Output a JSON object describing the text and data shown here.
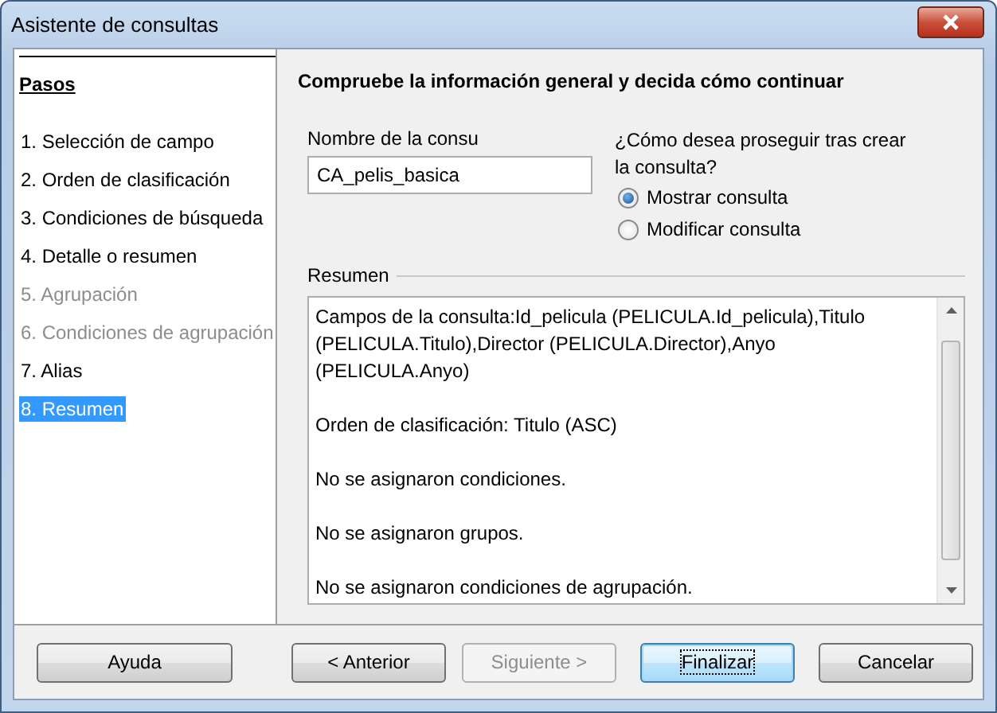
{
  "window": {
    "title": "Asistente de consultas"
  },
  "steps": {
    "heading": "Pasos",
    "items": [
      {
        "label": "1. Selección de campo",
        "selected": false,
        "disabled": false
      },
      {
        "label": "2. Orden de clasificación",
        "selected": false,
        "disabled": false
      },
      {
        "label": "3. Condiciones de búsqueda",
        "selected": false,
        "disabled": false
      },
      {
        "label": "4. Detalle o resumen",
        "selected": false,
        "disabled": false
      },
      {
        "label": "5. Agrupación",
        "selected": false,
        "disabled": true
      },
      {
        "label": "6. Condiciones de agrupación",
        "selected": false,
        "disabled": true
      },
      {
        "label": "7. Alias",
        "selected": false,
        "disabled": false
      },
      {
        "label": "8. Resumen",
        "selected": true,
        "disabled": false
      }
    ]
  },
  "page": {
    "heading": "Compruebe la información general y decida cómo continuar",
    "name_field": {
      "label": "Nombre de la consu",
      "value": "CA_pelis_basica"
    },
    "continue": {
      "question": "¿Cómo desea proseguir tras crear la consulta?",
      "options": [
        {
          "label": "Mostrar consulta",
          "selected": true
        },
        {
          "label": "Modificar consulta",
          "selected": false
        }
      ]
    },
    "summary": {
      "label": "Resumen",
      "lines": [
        "Campos de la consulta:Id_pelicula (PELICULA.Id_pelicula),Titulo (PELICULA.Titulo),Director (PELICULA.Director),Anyo (PELICULA.Anyo)",
        "Orden de clasificación: Titulo (ASC)",
        "No se asignaron condiciones.",
        "No se asignaron grupos.",
        "No se asignaron condiciones de agrupación."
      ]
    }
  },
  "buttons": [
    {
      "label": "Ayuda",
      "disabled": false,
      "default": false
    },
    {
      "label": "< Anterior",
      "disabled": false,
      "default": false
    },
    {
      "label": "Siguiente >",
      "disabled": true,
      "default": false
    },
    {
      "label": "Finalizar",
      "disabled": false,
      "default": true
    },
    {
      "label": "Cancelar",
      "disabled": false,
      "default": false
    }
  ]
}
